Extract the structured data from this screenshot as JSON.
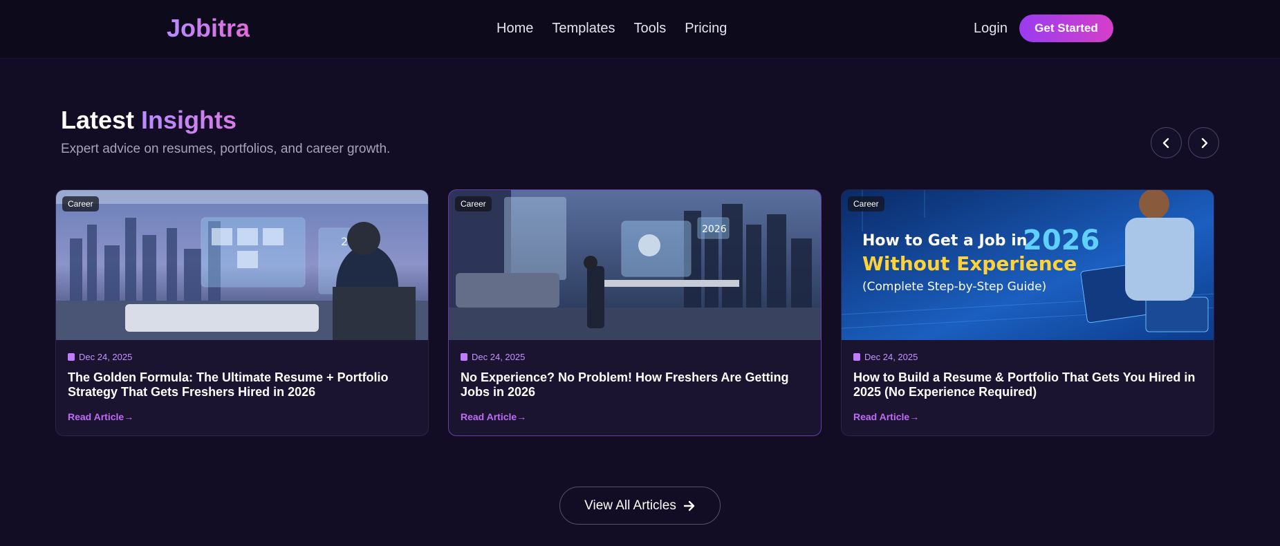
{
  "brand": {
    "logo": "Jobitra"
  },
  "nav": {
    "items": [
      "Home",
      "Templates",
      "Tools",
      "Pricing"
    ]
  },
  "auth": {
    "login": "Login",
    "cta": "Get Started"
  },
  "section": {
    "title_main": "Latest",
    "title_accent": "Insights",
    "subtitle": "Expert advice on resumes, portfolios, and career growth."
  },
  "cards": [
    {
      "tag": "Career",
      "date": "Dec 24, 2025",
      "title": "The Golden Formula: The Ultimate Resume + Portfolio Strategy That Gets Freshers Hired in 2026",
      "read_more": "Read Article",
      "image_text": "2030"
    },
    {
      "tag": "Career",
      "date": "Dec 24, 2025",
      "title": "No Experience? No Problem! How Freshers Are Getting Jobs in 2026",
      "read_more": "Read Article",
      "image_text": "2026"
    },
    {
      "tag": "Career",
      "date": "Dec 24, 2025",
      "title": "How to Build a Resume & Portfolio That Gets You Hired in 2025 (No Experience Required)",
      "read_more": "Read Article",
      "image_line1": "How to Get a Job in",
      "image_year": "2026",
      "image_line2": "Without Experience",
      "image_line3": "(Complete Step-by-Step Guide)"
    }
  ],
  "view_all": "View All Articles",
  "icons": {
    "prev": "chevron-left-icon",
    "next": "chevron-right-icon",
    "calendar": "calendar-icon",
    "arrow": "arrow-right-icon"
  },
  "colors": {
    "background": "#120c25",
    "accent": "#b98cff",
    "cta_start": "#9a3cf0",
    "cta_end": "#d53fc9"
  }
}
